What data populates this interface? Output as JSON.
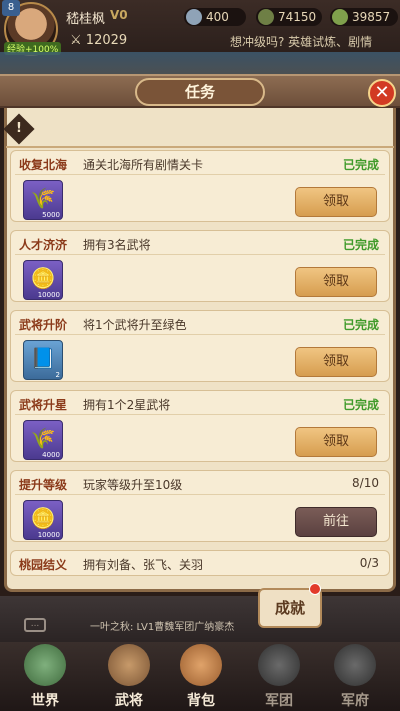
{
  "hud": {
    "level": "8",
    "xp_bonus": "经验+100%",
    "player_name": "嵇桂枫",
    "vip": "V0",
    "power": "12029",
    "resources": [
      "400",
      "74150",
      "39857"
    ],
    "ticker": "想冲级吗? 英雄试炼、剧情"
  },
  "panel": {
    "title": "任务",
    "close": "✕",
    "warn": "!"
  },
  "tasks": [
    {
      "name": "收复北海",
      "desc": "通关北海所有剧情关卡",
      "status": "已完成",
      "reward_qty": "5000",
      "button": "领取"
    },
    {
      "name": "人才济济",
      "desc": "拥有3名武将",
      "status": "已完成",
      "reward_qty": "10000",
      "button": "领取"
    },
    {
      "name": "武将升阶",
      "desc": "将1个武将升至绿色",
      "status": "已完成",
      "reward_qty": "2",
      "button": "领取"
    },
    {
      "name": "武将升星",
      "desc": "拥有1个2星武将",
      "status": "已完成",
      "reward_qty": "4000",
      "button": "领取"
    },
    {
      "name": "提升等级",
      "desc": "玩家等级升至10级",
      "status": "8/10",
      "reward_qty": "10000",
      "button": "前往"
    },
    {
      "name": "桃园结义",
      "desc": "拥有刘备、张飞、关羽",
      "status": "0/3"
    }
  ],
  "chat": {
    "icon": "...",
    "text": "一叶之秋: LV1曹魏军团广纳豪杰"
  },
  "achievements": "成就",
  "nav": [
    "世界",
    "武将",
    "背包",
    "军团",
    "军府"
  ],
  "colors": {
    "done": "#3f9a2a",
    "claim_button": "#e4b06a",
    "go_button": "#6b4e4b"
  }
}
